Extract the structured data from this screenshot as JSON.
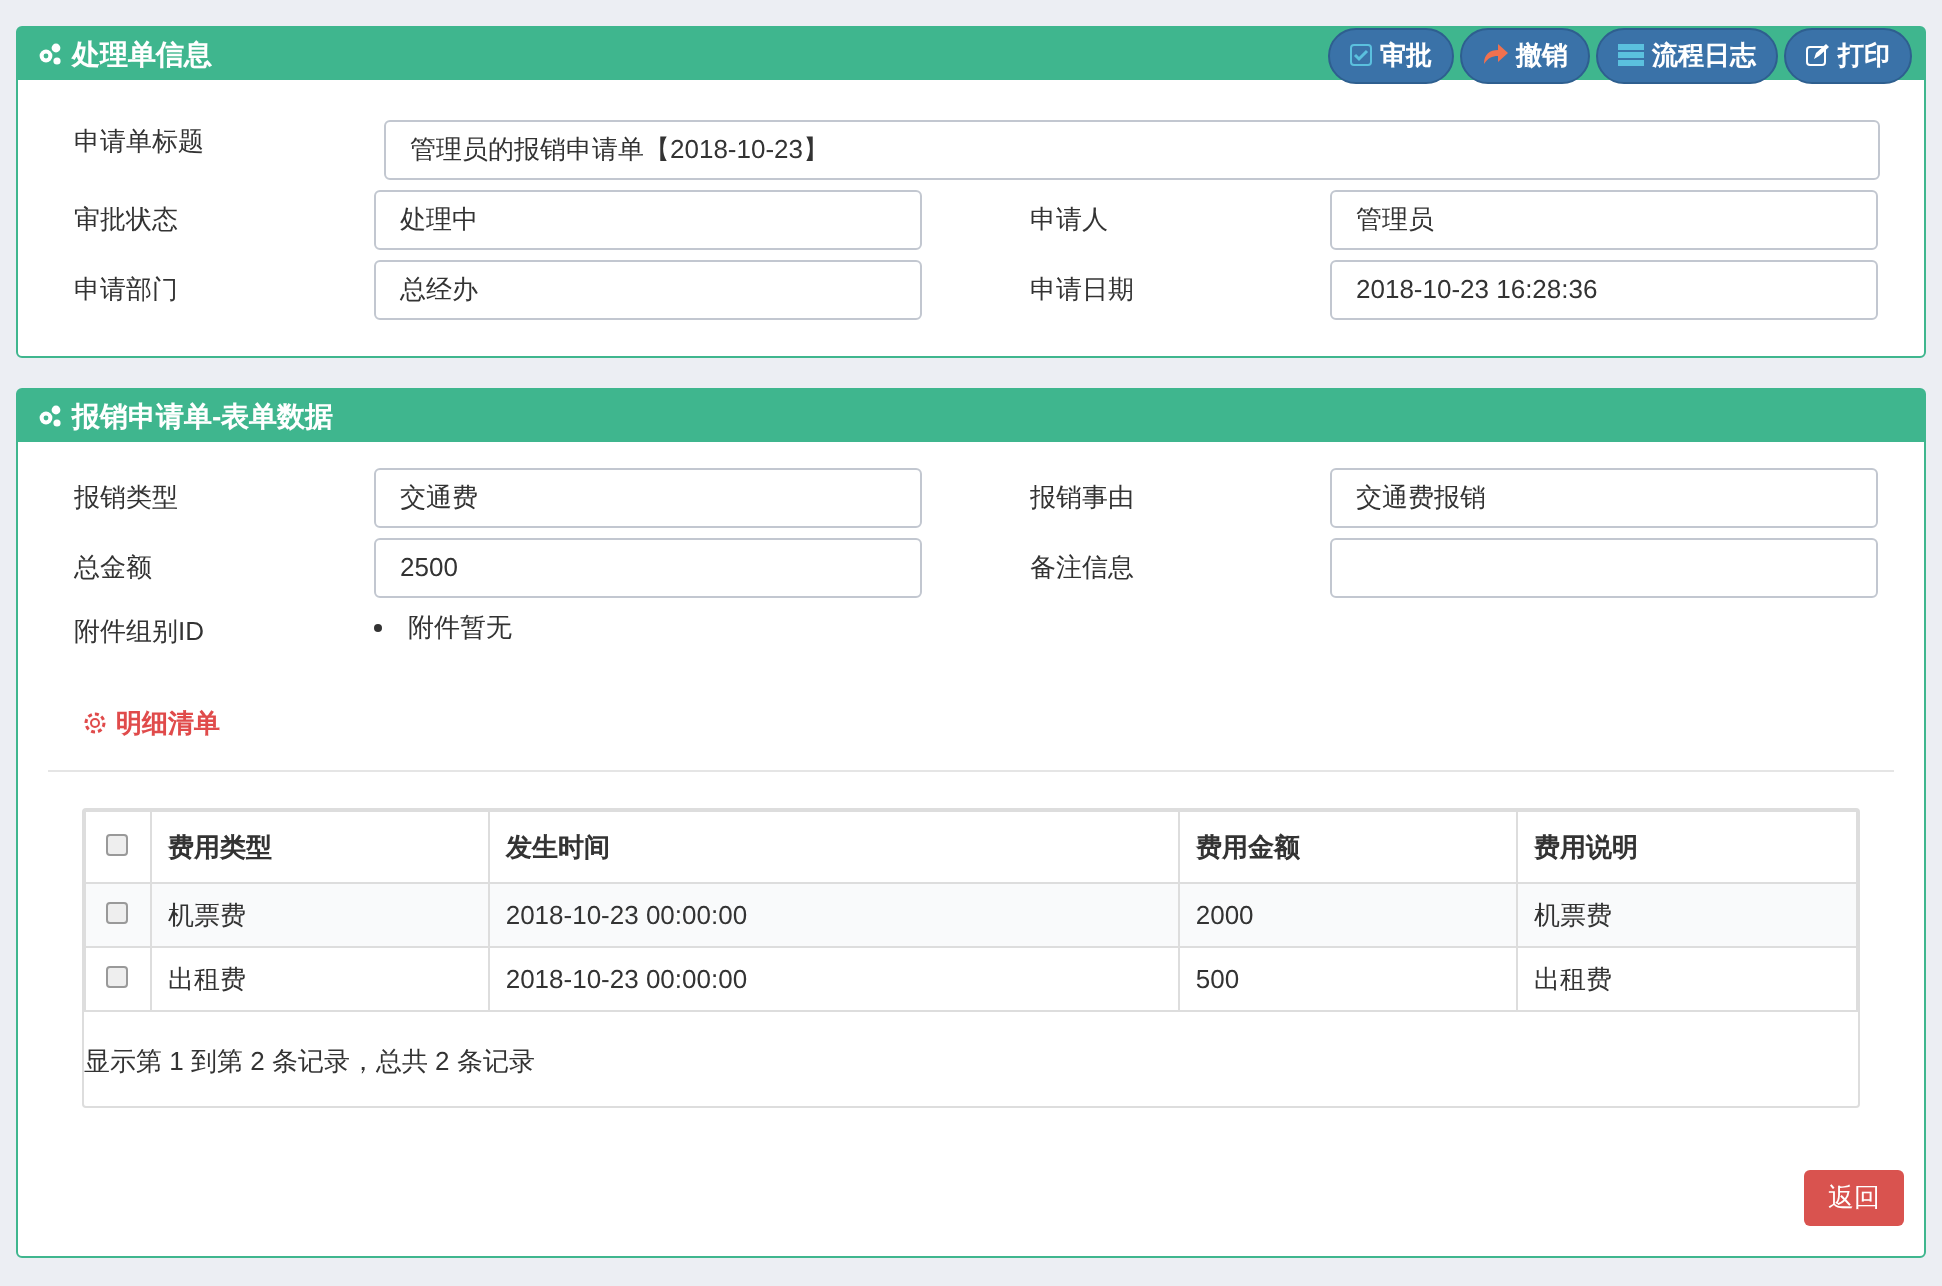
{
  "info_panel": {
    "title": "处理单信息",
    "buttons": [
      {
        "label": "审批",
        "kind": "approve"
      },
      {
        "label": "撤销",
        "kind": "revoke"
      },
      {
        "label": "流程日志",
        "kind": "log"
      },
      {
        "label": "打印",
        "kind": "print"
      }
    ],
    "title_field": {
      "label": "申请单标题",
      "value": "管理员的报销申请单【2018-10-23】"
    },
    "fields": [
      {
        "label": "审批状态",
        "value": "处理中"
      },
      {
        "label": "申请人",
        "value": "管理员"
      },
      {
        "label": "申请部门",
        "value": "总经办"
      },
      {
        "label": "申请日期",
        "value": "2018-10-23 16:28:36"
      }
    ]
  },
  "form_panel": {
    "title": "报销申请单-表单数据",
    "fields": [
      {
        "label": "报销类型",
        "value": "交通费"
      },
      {
        "label": "报销事由",
        "value": "交通费报销"
      },
      {
        "label": "总金额",
        "value": "2500"
      },
      {
        "label": "备注信息"
      }
    ],
    "attachment": {
      "label": "附件组别ID",
      "items": [
        "附件暂无"
      ]
    },
    "detail_title": "明细清单",
    "table": {
      "header_checked": false,
      "columns": [
        "费用类型",
        "发生时间",
        "费用金额",
        "费用说明"
      ],
      "rows": [
        {
          "checked": false,
          "cells": [
            "机票费",
            "2018-10-23 00:00:00",
            "2000",
            "机票费"
          ]
        },
        {
          "checked": false,
          "cells": [
            "出租费",
            "2018-10-23 00:00:00",
            "500",
            "出租费"
          ]
        }
      ],
      "footer": "显示第 1 到第 2 条记录，总共 2 条记录"
    },
    "back_button": "返回"
  }
}
